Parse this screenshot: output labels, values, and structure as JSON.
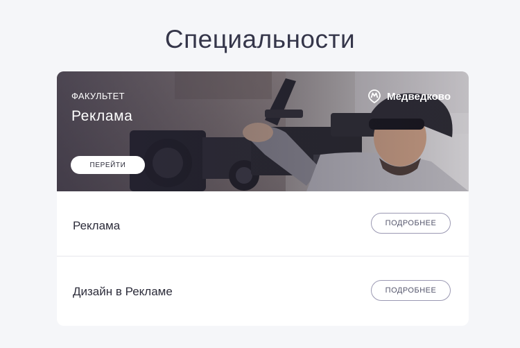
{
  "page": {
    "title": "Специальности"
  },
  "faculty": {
    "label": "ФАКУЛЬТЕТ",
    "name": "Реклама",
    "metro_station": "Медведково",
    "go_button": "ПЕРЕЙТИ",
    "metro_icon": "metro-icon"
  },
  "specialties": [
    {
      "name": "Реклама",
      "button": "ПОДРОБНЕЕ"
    },
    {
      "name": "Дизайн в Рекламе",
      "button": "ПОДРОБНЕЕ"
    }
  ],
  "colors": {
    "background": "#f5f6f9",
    "card": "#ffffff",
    "hero_overlay": "#28263c",
    "button_border": "#9a98b2"
  }
}
